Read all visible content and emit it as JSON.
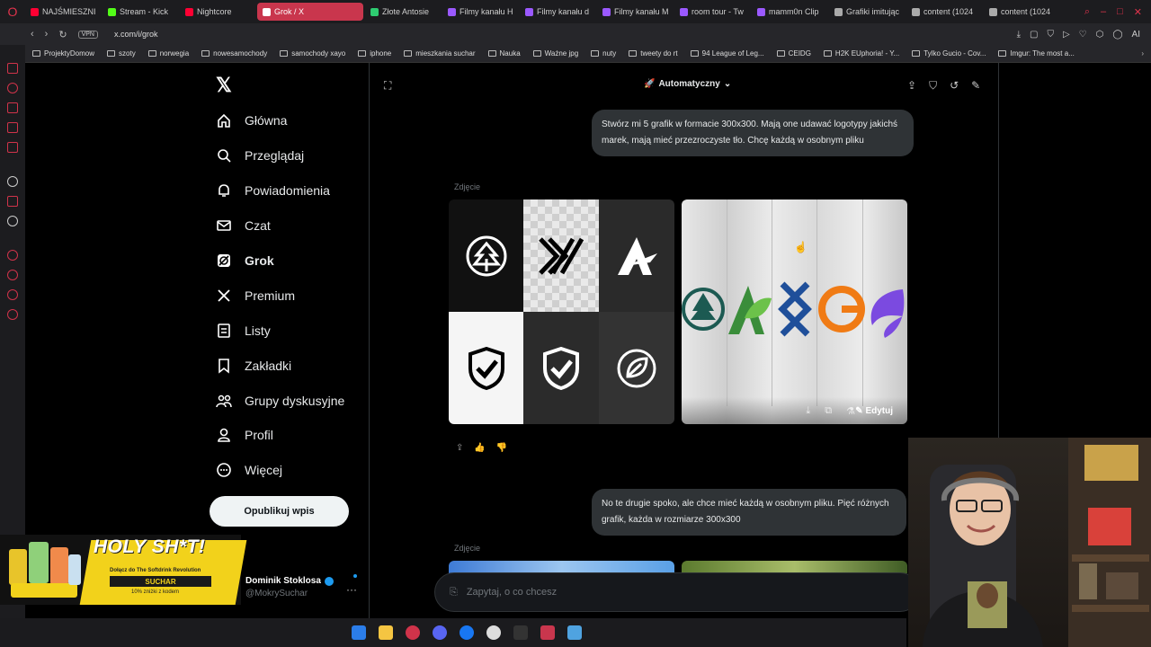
{
  "browser": {
    "tabs": [
      {
        "label": "NAJŚMIESZNI",
        "color": "#ff0033"
      },
      {
        "label": "Stream - Kick",
        "color": "#53fc18"
      },
      {
        "label": "Nightcore",
        "color": "#ff0033"
      },
      {
        "label": "Grok / X",
        "color": "#ffffff",
        "active": true
      },
      {
        "label": "Złote Antosie",
        "color": "#2ecc71"
      },
      {
        "label": "Filmy kanału H",
        "color": "#9b59ff"
      },
      {
        "label": "Filmy kanału d",
        "color": "#9b59ff"
      },
      {
        "label": "Filmy kanału M",
        "color": "#9b59ff"
      },
      {
        "label": "room tour - Tw",
        "color": "#9b59ff"
      },
      {
        "label": "mamm0n Clip",
        "color": "#9b59ff"
      },
      {
        "label": "Grafiki imitując",
        "color": "#aaaaaa"
      },
      {
        "label": "content (1024",
        "color": "#aaaaaa"
      },
      {
        "label": "content (1024",
        "color": "#aaaaaa"
      }
    ],
    "url": "x.com/i/grok",
    "vpn": "VPN",
    "bookmarks": [
      "ProjektyDomow",
      "szoty",
      "norwegia",
      "nowesamochody",
      "samochody xayo",
      "iphone",
      "mieszkania suchar",
      "Nauka",
      "Ważne jpg",
      "nuty",
      "tweety do rt",
      "94 League of Leg...",
      "CEIDG",
      "H2K EUphoria! - Y...",
      "Tylko Gucio - Cov...",
      "Imgur: The most a..."
    ]
  },
  "nav": {
    "items": [
      {
        "label": "Główna",
        "icon": "home-icon"
      },
      {
        "label": "Przeglądaj",
        "icon": "search-icon"
      },
      {
        "label": "Powiadomienia",
        "icon": "bell-icon"
      },
      {
        "label": "Czat",
        "icon": "mail-icon"
      },
      {
        "label": "Grok",
        "icon": "grok-icon"
      },
      {
        "label": "Premium",
        "icon": "x-icon"
      },
      {
        "label": "Listy",
        "icon": "list-icon"
      },
      {
        "label": "Zakładki",
        "icon": "bookmark-icon"
      },
      {
        "label": "Grupy dyskusyjne",
        "icon": "people-icon"
      },
      {
        "label": "Profil",
        "icon": "person-icon"
      },
      {
        "label": "Więcej",
        "icon": "more-icon"
      }
    ],
    "post_label": "Opublikuj wpis",
    "user_name": "Dominik Stoklosa",
    "user_handle": "@MokrySuchar"
  },
  "chat": {
    "mode": "Automatyczny",
    "msg1": "Stwórz mi 5 grafik w formacie 300x300. Mają one udawać logotypy jakichś marek, mają mieć przezroczyste tło. Chcę każdą w osobnym pliku",
    "photo_label": "Zdjęcie",
    "edit_label": "Edytuj",
    "msg2": "No te drugie spoko, ale chce mieć każdą w osobnym pliku. Pięć różnych grafik, każda w rozmiarze 300x300",
    "photo_label2": "Zdjęcie",
    "placeholder": "Zapytaj, o co chcesz"
  },
  "ad": {
    "headline": "HOLY SH*T!",
    "sub": "Dołącz do The Softdrink Revolution",
    "brand": "SUCHAR",
    "discount": "10% zniżki z kodem"
  }
}
